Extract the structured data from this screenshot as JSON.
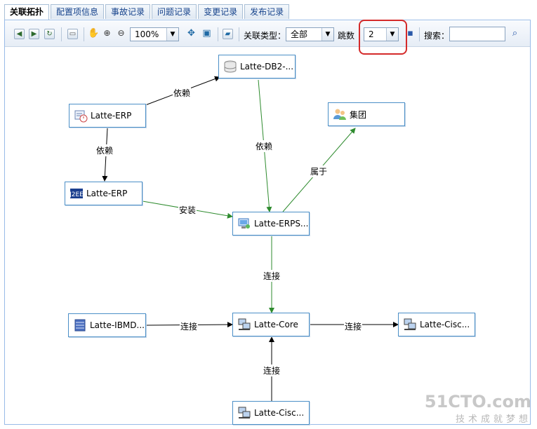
{
  "tabs": [
    "关联拓扑",
    "配置项信息",
    "事故记录",
    "问题记录",
    "变更记录",
    "发布记录"
  ],
  "toolbar": {
    "zoom": "100%",
    "relation_type_label": "关联类型：",
    "relation_type_value": "全部",
    "hops_label": "跳数",
    "hops_value": "2",
    "search_label": "搜索："
  },
  "nodes": {
    "db2": "Latte-DB2-...",
    "erp_top": "Latte-ERP",
    "group": "集团",
    "erp_mid": "Latte-ERP",
    "erps": "Latte-ERPS...",
    "ibmd": "Latte-IBMD...",
    "core": "Latte-Core",
    "cisco_right": "Latte-Cisc...",
    "cisco_bottom": "Latte-Cisc..."
  },
  "edges": {
    "erp_db2": "依赖",
    "erp_erp": "依赖",
    "db2_erps": "依赖",
    "erps_group": "属于",
    "erp_erps": "安装",
    "erps_core": "连接",
    "ibmd_core": "连接",
    "core_cisco": "连接",
    "cisco_core": "连接"
  },
  "watermark": {
    "brand": "51CTO.com",
    "slogan": "技术成就梦想"
  }
}
